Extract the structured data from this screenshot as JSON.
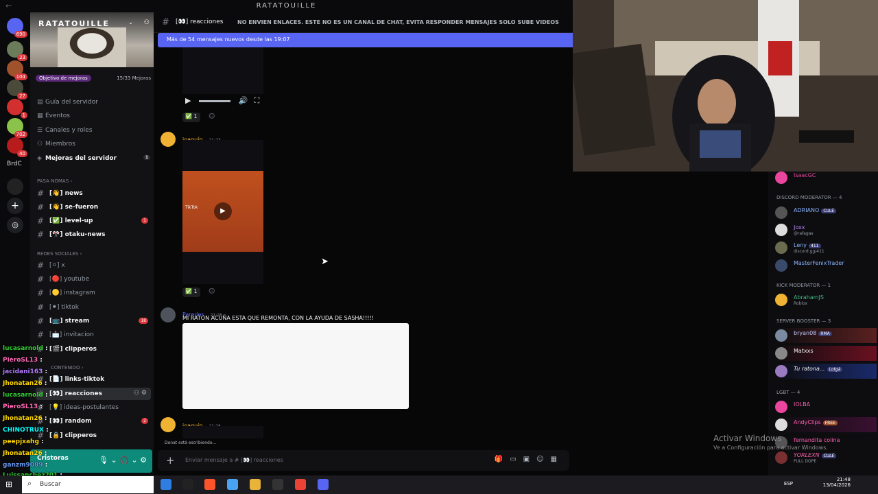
{
  "window": {
    "title": "RATATOUILLE"
  },
  "server": {
    "name": "RATATOUILLE",
    "boost_goal": "Objetivo de mejoras",
    "boost_count": "15/33 Mejoras",
    "menu": [
      {
        "icon": "guide-icon",
        "label": "Guía del servidor"
      },
      {
        "icon": "calendar-icon",
        "label": "Eventos"
      },
      {
        "icon": "channels-icon",
        "label": "Canales y roles"
      },
      {
        "icon": "members-icon",
        "label": "Miembros"
      },
      {
        "icon": "boost-icon",
        "label": "Mejoras del servidor",
        "badge": "1"
      }
    ]
  },
  "rail": {
    "home_badge": "690",
    "servers": [
      {
        "badge": "23"
      },
      {
        "badge": "104"
      },
      {
        "badge": "27"
      },
      {
        "badge": "1"
      },
      {
        "badge": "702"
      },
      {
        "badge": "40"
      }
    ],
    "text_server": "BrdC"
  },
  "categories": {
    "c1": "PASA NOMAS",
    "c2": "REDES SOCIALES",
    "c3": "CONTENIDO"
  },
  "channels": [
    {
      "label": "[👋] news",
      "bold": true
    },
    {
      "label": "[👋] se-fueron",
      "bold": true
    },
    {
      "label": "[✅] level-up",
      "bold": true,
      "badge": "1"
    },
    {
      "label": "[🎌] otaku-news",
      "bold": true
    },
    {
      "label": "[⚪] x",
      "bold": false
    },
    {
      "label": "[🔴] youtube",
      "bold": false
    },
    {
      "label": "[🟡] instagram",
      "bold": false
    },
    {
      "label": "[⚫] tiktok",
      "bold": false
    },
    {
      "label": "[📺] stream",
      "bold": true,
      "badge": "18"
    },
    {
      "label": "[📩] invitacion",
      "bold": false
    },
    {
      "label": "[🎬] clipperos",
      "bold": true
    },
    {
      "label": "[📄] links-tiktok",
      "bold": true
    },
    {
      "label": "[👀] reacciones",
      "bold": true,
      "active": true
    },
    {
      "label": "[💡] ideas-postulantes",
      "bold": false
    },
    {
      "label": "[👀] random",
      "bold": true,
      "badge": "2"
    },
    {
      "label": "[🔒] clipperos",
      "bold": true
    }
  ],
  "stream_chat": [
    {
      "user": "lucasarnold",
      "color": "#32cd32"
    },
    {
      "user": "PieroSL13",
      "color": "#ff69b4"
    },
    {
      "user": "jacidani163",
      "color": "#b57bff"
    },
    {
      "user": "Jhonatan26",
      "color": "#ffd700"
    },
    {
      "user": "lucasarnold",
      "color": "#32cd32"
    },
    {
      "user": "PieroSL13",
      "color": "#ff69b4"
    },
    {
      "user": "Jhonatan26",
      "color": "#ffd700"
    },
    {
      "user": "CHINOTRUX",
      "color": "#00ffff"
    },
    {
      "user": "peepjxahg",
      "color": "#ffd700"
    },
    {
      "user": "Jhonatan26",
      "color": "#ffd700"
    },
    {
      "user": "ganzm9089",
      "color": "#6495ed"
    },
    {
      "user": "Luissanchez201",
      "color": "#32cd32"
    }
  ],
  "user_panel": {
    "name": "Cristoras"
  },
  "channel_header": {
    "name": "[👀] reacciones",
    "topic": "NO ENVIEN ENLACES. ESTE NO ES UN CANAL DE CHAT, EVITA RESPONDER MENSAJES SOLO SUBE VIDEOS"
  },
  "new_messages_bar": "Más de 54 mensajes nuevos desde las 19:07",
  "messages": [
    {
      "author": "joaquín",
      "time": "21:23",
      "reaction_count": "1",
      "video_label": "TikTok"
    },
    {
      "author": "Paredes",
      "time": "21:26",
      "text": "MI RATON ACUÑA ESTA QUE REMONTA, CON LA AYUDA DE SASHA!!!!!"
    },
    {
      "author": "joaquín",
      "time": "21:28"
    }
  ],
  "first_reaction_count": "1",
  "typing_indicator": "Donat está escribiendo...",
  "composer": {
    "placeholder": "Enviar mensaje a # [👀] reacciones"
  },
  "members": {
    "top_member": "IsaacGC",
    "groups": [
      {
        "label": "DISCORD MODERATOR — 4"
      },
      {
        "label": "KICK MODERATOR — 1"
      },
      {
        "label": "SERVER BOOSTER — 3"
      },
      {
        "label": "LGBT — 4"
      }
    ],
    "list": [
      {
        "name": "ADRIANO",
        "tag": "CULÉ",
        "color": "#8ab4ff"
      },
      {
        "name": "Joxx",
        "sub": "@rafagas",
        "color": "#c08aff"
      },
      {
        "name": "Leny",
        "tag": "411",
        "sub": "discord.gg/411",
        "color": "#8ab4ff"
      },
      {
        "name": "MasterFenixTrader",
        "color": "#8ab4ff"
      },
      {
        "name": "AbrahamJS",
        "sub": "Roblox",
        "color": "#43b581"
      },
      {
        "name": "bryan08",
        "tag": "RMA",
        "color": "#c5cbff"
      },
      {
        "name": "Matxxs",
        "color": "#f2f3f5"
      },
      {
        "name": "Tu ratona...",
        "tag": "Lotgà",
        "color": "#f2f3f5"
      },
      {
        "name": "IOLBA",
        "color": "#ff5fae"
      },
      {
        "name": "AndyClips",
        "tag": "FREE",
        "color": "#ff5fae"
      },
      {
        "name": "fernandita colina",
        "color": "#ff5fae"
      },
      {
        "name": "YORLEXN",
        "tag": "CULÉ",
        "sub": "FULL DOPE",
        "color": "#ff5fae"
      }
    ]
  },
  "activate_windows": {
    "title": "Activar Windows",
    "sub": "Ve a Configuración para activar Windows."
  },
  "taskbar": {
    "search": "Buscar",
    "lang": "ESP",
    "time": "21:48",
    "date": "13/04/2026"
  },
  "colors": {
    "blurple": "#5865f2",
    "mention_red": "#da373c",
    "user_panel": "#0d8a7a"
  }
}
